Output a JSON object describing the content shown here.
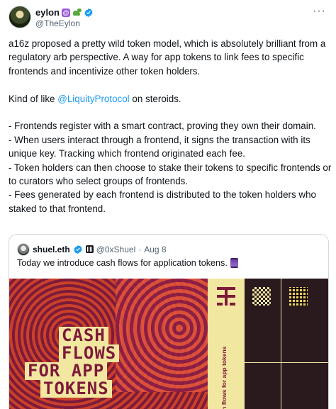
{
  "author": {
    "name": "eylon",
    "handle": "@TheEylon"
  },
  "post": {
    "p1": "a16z proposed a pretty wild token model, which is absolutely brilliant from a regulatory arb perspective. A way for app tokens to link fees to specific frontends and incentivize other token holders.",
    "p2_pre": "Kind of like ",
    "p2_mention": "@LiquityProtocol",
    "p2_post": " on steroids.",
    "bullets": [
      "- Frontends register with a smart contract, proving they own their domain.",
      "- When users interact through a frontend, it signs the transaction with its unique key. Tracking which frontend originated each fee.",
      "- Token holders can then choose to stake their tokens to specific frontends or to curators who select groups of frontends.",
      "- Fees generated by each frontend is distributed to the token holders who staked to that frontend."
    ]
  },
  "quote": {
    "name": "shuel.eth",
    "handle": "@0xShuel",
    "separator": "·",
    "date": "Aug 8",
    "text": "Today we introduce cash flows for application tokens.",
    "image": {
      "title_lines": [
        "CASH",
        "FLOWS",
        "FOR APP",
        "TOKENS"
      ],
      "side_text": "cash flows for app tokens"
    }
  },
  "colors": {
    "link": "#1d9bf0",
    "verified": "#1d9bf0",
    "muted": "#536471",
    "art_yellow": "#f2e7a0",
    "art_maroon": "#7d1a3a"
  },
  "icons": {
    "more": "more-options-icon",
    "verified": "verified-badge-icon"
  }
}
